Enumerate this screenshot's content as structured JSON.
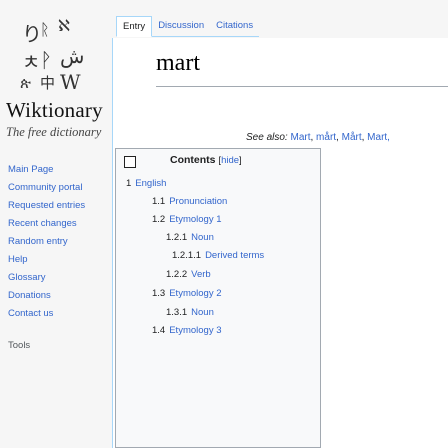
{
  "sidebar": {
    "logo_glyphs": [
      "り",
      "ᚱ",
      "ℵ",
      "ㅊ",
      "ᚹ",
      "ش",
      "ጵ",
      "中",
      "W"
    ],
    "site_title": "Wiktionary",
    "tagline": "The free dictionary",
    "nav_main": [
      {
        "label": "Main Page"
      },
      {
        "label": "Community portal"
      },
      {
        "label": "Requested entries"
      },
      {
        "label": "Recent changes"
      },
      {
        "label": "Random entry"
      },
      {
        "label": "Help"
      },
      {
        "label": "Glossary"
      },
      {
        "label": "Donations"
      },
      {
        "label": "Contact us"
      }
    ],
    "nav_tools": {
      "label": "Tools"
    }
  },
  "tabs": [
    {
      "label": "Entry"
    },
    {
      "label": "Discussion"
    },
    {
      "label": "Citations"
    }
  ],
  "page": {
    "title": "mart",
    "see_also_label": "See also:",
    "see_also_links": [
      "Mart",
      "mårt",
      "Mårt",
      "Mart,"
    ]
  },
  "toc": {
    "title": "Contents",
    "hide_open": "[",
    "hide_label": "hide",
    "hide_close": "]",
    "items": [
      {
        "num": "1",
        "label": "English"
      },
      {
        "num": "1.1",
        "label": "Pronunciation"
      },
      {
        "num": "1.2",
        "label": "Etymology 1"
      },
      {
        "num": "1.2.1",
        "label": "Noun"
      },
      {
        "num": "1.2.1.1",
        "label": "Derived terms"
      },
      {
        "num": "1.2.2",
        "label": "Verb"
      },
      {
        "num": "1.3",
        "label": "Etymology 2"
      },
      {
        "num": "1.3.1",
        "label": "Noun"
      },
      {
        "num": "1.4",
        "label": "Etymology 3"
      }
    ]
  },
  "colors": {
    "link": "#36c",
    "border": "#a7d7f9",
    "toc_bg": "#f8f9fa"
  }
}
